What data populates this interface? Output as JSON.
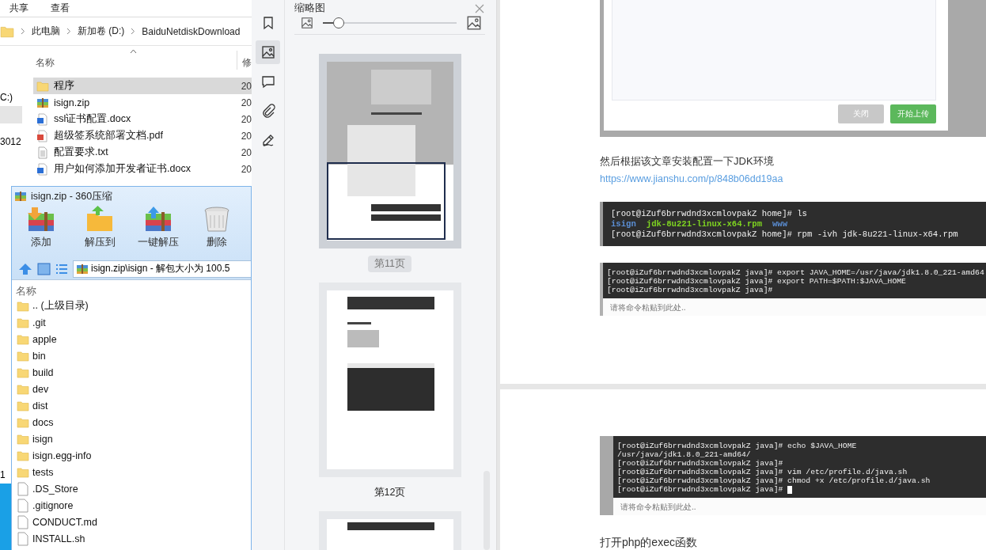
{
  "explorer": {
    "menu": [
      "共享",
      "查看"
    ],
    "breadcrumb": [
      "此电脑",
      "新加卷 (D:)",
      "BaiduNetdiskDownload"
    ],
    "nav_items": [
      {
        "label": "C:)",
        "selected": false
      },
      {
        "selected": true
      },
      {
        "label": "3012",
        "selected": false
      },
      {
        "label": "1",
        "selected": false
      }
    ],
    "columns": [
      "名称",
      "修"
    ],
    "files": [
      {
        "name": "程序",
        "kind": "folder",
        "date": "20",
        "selected": true
      },
      {
        "name": "isign.zip",
        "kind": "zip",
        "date": "20",
        "selected": false
      },
      {
        "name": "ssl证书配置.docx",
        "kind": "word",
        "date": "20",
        "selected": false
      },
      {
        "name": "超级签系统部署文档.pdf",
        "kind": "pdf",
        "date": "20",
        "selected": false
      },
      {
        "name": "配置要求.txt",
        "kind": "text",
        "date": "20",
        "selected": false
      },
      {
        "name": "用户如何添加开发者证书.docx",
        "kind": "word",
        "date": "20",
        "selected": false
      }
    ]
  },
  "zip_window": {
    "title": "isign.zip - 360压缩",
    "tools": [
      {
        "label": "添加",
        "kind": "add"
      },
      {
        "label": "解压到",
        "kind": "extract"
      },
      {
        "label": "一键解压",
        "kind": "quick"
      },
      {
        "label": "删除",
        "kind": "delete"
      }
    ],
    "path": "isign.zip\\isign - 解包大小为 100.5",
    "column": "名称",
    "entries": [
      {
        "name": ".. (上级目录)",
        "kind": "folder"
      },
      {
        "name": ".git",
        "kind": "folder"
      },
      {
        "name": "apple",
        "kind": "folder"
      },
      {
        "name": "bin",
        "kind": "folder"
      },
      {
        "name": "build",
        "kind": "folder"
      },
      {
        "name": "dev",
        "kind": "folder"
      },
      {
        "name": "dist",
        "kind": "folder"
      },
      {
        "name": "docs",
        "kind": "folder"
      },
      {
        "name": "isign",
        "kind": "folder"
      },
      {
        "name": "isign.egg-info",
        "kind": "folder"
      },
      {
        "name": "tests",
        "kind": "folder"
      },
      {
        "name": ".DS_Store",
        "kind": "file"
      },
      {
        "name": ".gitignore",
        "kind": "file"
      },
      {
        "name": "CONDUCT.md",
        "kind": "file"
      },
      {
        "name": "INSTALL.sh",
        "kind": "file"
      }
    ]
  },
  "pdf_sidebar": {
    "tools": [
      {
        "kind": "bookmark",
        "selected": false
      },
      {
        "kind": "thumbnail",
        "selected": true
      },
      {
        "kind": "comment",
        "selected": false
      },
      {
        "kind": "attachment",
        "selected": false
      },
      {
        "kind": "signature",
        "selected": false
      }
    ],
    "title": "缩略图",
    "zoom": {
      "level": 0.12
    },
    "thumbnails": [
      {
        "label": "第11页",
        "selected": true
      },
      {
        "label": "第12页",
        "selected": false
      },
      {
        "selected": false
      }
    ]
  },
  "document": {
    "pages": [
      {
        "blocks": [
          {
            "kind": "dialog_screenshot",
            "buttons": [
              {
                "label": "关闭",
                "kind": "secondary"
              },
              {
                "label": "开始上传",
                "kind": "primary"
              }
            ]
          },
          {
            "kind": "paragraph",
            "text": "然后根据该文章安装配置一下JDK环境"
          },
          {
            "kind": "link",
            "text": "https://www.jianshu.com/p/848b06dd19aa"
          },
          {
            "kind": "terminal",
            "lines": [
              {
                "segments": [
                  {
                    "text": "[root@iZuf6brrwdnd3xcmlovpakZ home]# ls"
                  }
                ]
              },
              {
                "segments": [
                  {
                    "text": "isign",
                    "color": "#5b8fd6"
                  },
                  {
                    "text": "jdk-8u221-linux-x64.rpm",
                    "color": "#7ed321"
                  },
                  {
                    "text": "www",
                    "color": "#5b8fd6"
                  }
                ]
              },
              {
                "segments": [
                  {
                    "text": "[root@iZuf6brrwdnd3xcmlovpakZ home]# rpm -ivh jdk-8u221-linux-x64.rpm"
                  }
                ]
              }
            ]
          },
          {
            "kind": "terminal",
            "footer": "请将命令粘贴到此处..",
            "lines": [
              {
                "segments": [
                  {
                    "text": "[root@iZuf6brrwdnd3xcmlovpakZ java]# export JAVA_HOME=/usr/java/jdk1.8.0_221-amd64"
                  }
                ]
              },
              {
                "segments": [
                  {
                    "text": "[root@iZuf6brrwdnd3xcmlovpakZ java]# export PATH=$PATH:$JAVA_HOME"
                  }
                ]
              },
              {
                "segments": [
                  {
                    "text": "[root@iZuf6brrwdnd3xcmlovpakZ java]#"
                  }
                ]
              }
            ]
          }
        ]
      },
      {
        "blocks": [
          {
            "kind": "terminal",
            "footer": "请将命令粘贴到此处..",
            "lines": [
              {
                "segments": [
                  {
                    "text": "[root@iZuf6brrwdnd3xcmlovpakZ java]# echo $JAVA_HOME"
                  }
                ]
              },
              {
                "segments": [
                  {
                    "text": "/usr/java/jdk1.8.0_221-amd64/"
                  }
                ]
              },
              {
                "segments": [
                  {
                    "text": "[root@iZuf6brrwdnd3xcmlovpakZ java]#"
                  }
                ]
              },
              {
                "segments": [
                  {
                    "text": "[root@iZuf6brrwdnd3xcmlovpakZ java]# vim /etc/profile.d/java.sh"
                  }
                ]
              },
              {
                "segments": [
                  {
                    "text": "[root@iZuf6brrwdnd3xcmlovpakZ java]# chmod +x /etc/profile.d/java.sh"
                  }
                ]
              },
              {
                "cursor": true,
                "segments": [
                  {
                    "text": "[root@iZuf6brrwdnd3xcmlovpakZ java]#"
                  }
                ]
              }
            ]
          },
          {
            "kind": "heading",
            "text": "打开php的exec函数"
          }
        ]
      }
    ]
  }
}
